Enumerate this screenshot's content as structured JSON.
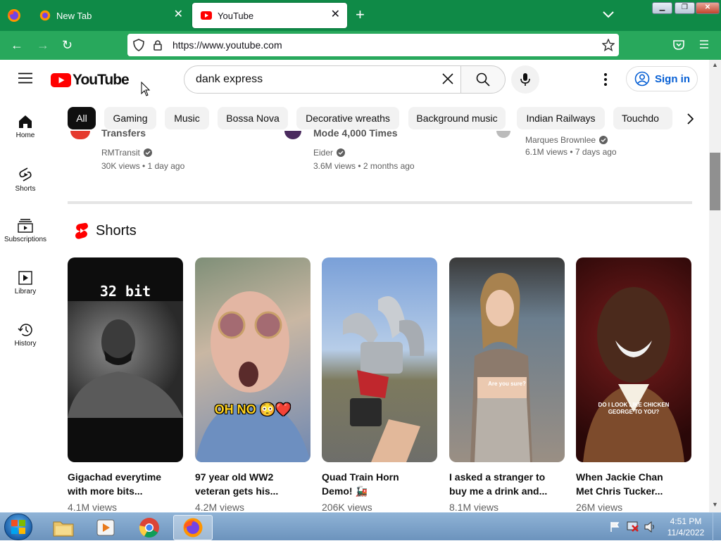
{
  "browser": {
    "tabs": [
      {
        "label": "New Tab"
      },
      {
        "label": "YouTube"
      }
    ],
    "url": "https://www.youtube.com"
  },
  "youtube": {
    "logo_text": "YouTube",
    "search_value": "dank express",
    "sign_in_label": "Sign in",
    "chips": [
      "All",
      "Gaming",
      "Music",
      "Bossa Nova",
      "Decorative wreaths",
      "Background music",
      "Indian Railways",
      "Touchdo"
    ],
    "sidebar": [
      {
        "label": "Home"
      },
      {
        "label": "Shorts"
      },
      {
        "label": "Subscriptions"
      },
      {
        "label": "Library"
      },
      {
        "label": "History"
      }
    ],
    "partial_videos": [
      {
        "title": "Transfers",
        "channel": "RMTransit",
        "stats": "30K views • 1 day ago"
      },
      {
        "title": "Mode 4,000 Times",
        "channel": "Eider",
        "stats": "3.6M views • 2 months ago"
      },
      {
        "title": "",
        "channel": "Marques Brownlee",
        "stats": "6.1M views • 7 days ago"
      }
    ],
    "shorts_heading": "Shorts",
    "shorts": [
      {
        "title_line1": "Gigachad everytime",
        "title_line2": "with more bits...",
        "views": "4.1M views",
        "overlay": "32 bit"
      },
      {
        "title_line1": "97 year old WW2",
        "title_line2": "veteran gets his...",
        "views": "4.2M views",
        "overlay": "OH NO 😳❤️"
      },
      {
        "title_line1": "Quad Train Horn",
        "title_line2": "Demo! 🚂",
        "views": "206K views",
        "overlay": ""
      },
      {
        "title_line1": "I asked a stranger to",
        "title_line2": "buy me a drink and...",
        "views": "8.1M views",
        "overlay": "Are you sure?"
      },
      {
        "title_line1": "When Jackie Chan",
        "title_line2": "Met Chris Tucker...",
        "views": "26M views",
        "overlay": "DO I LOOK LIKE CHICKEN GEORGE TO YOU?"
      }
    ]
  },
  "taskbar": {
    "time": "4:51 PM",
    "date": "11/4/2022"
  },
  "colors": {
    "firefox_tabbar": "#0f8a47",
    "firefox_navbar": "#28a85c",
    "youtube_red": "#ff0000",
    "signin_blue": "#065fd4"
  }
}
